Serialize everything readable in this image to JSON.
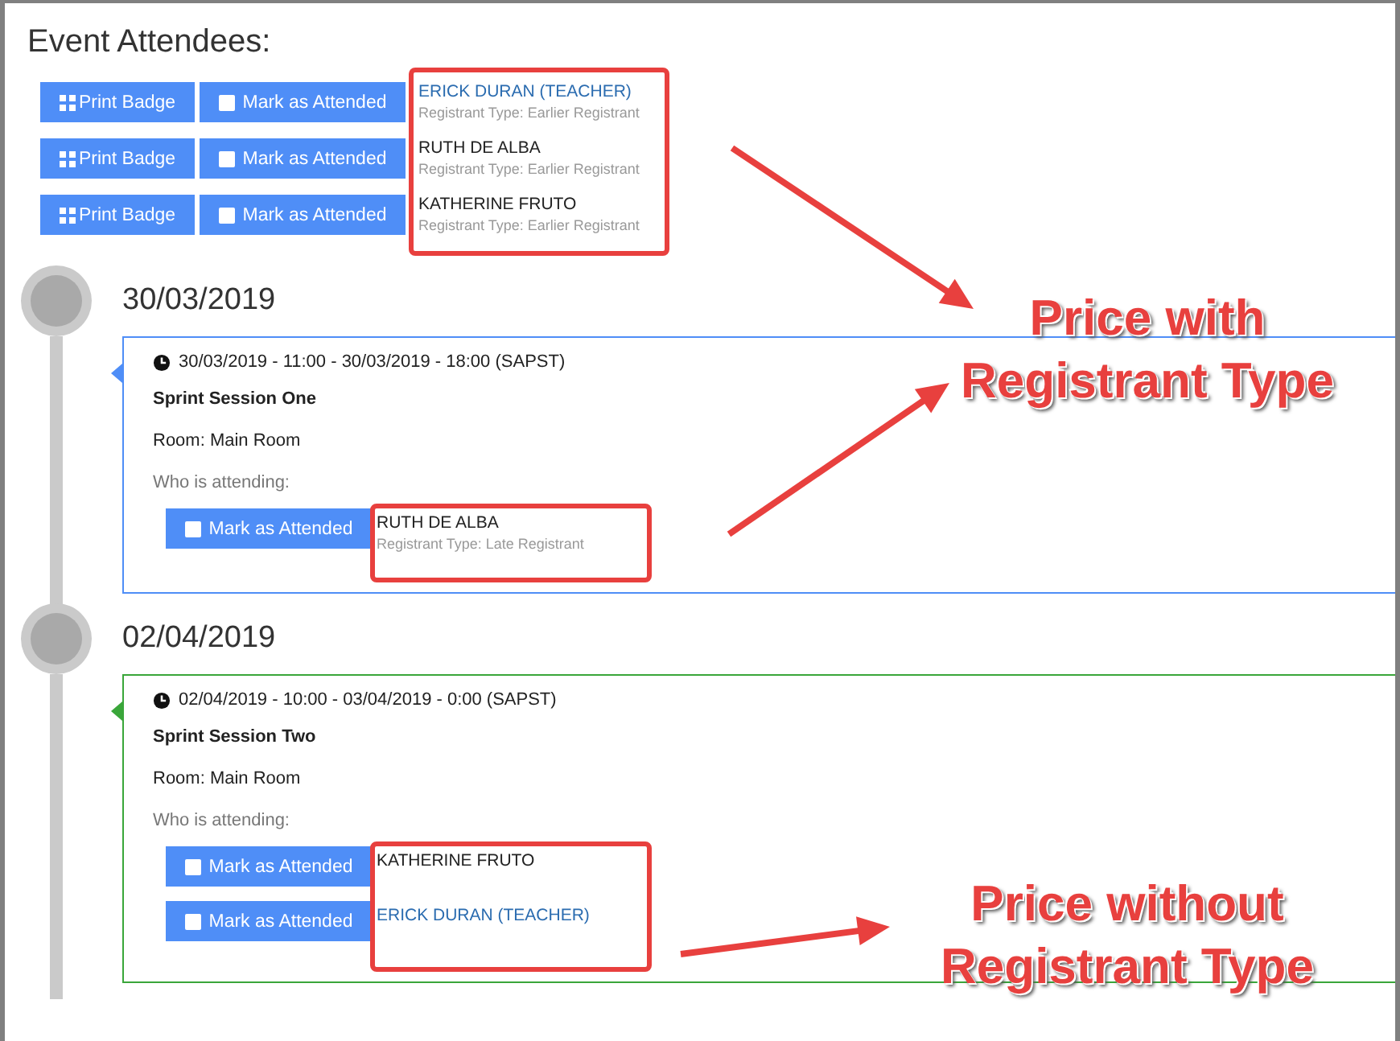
{
  "title": "Event Attendees:",
  "attendees": [
    {
      "print_label": "Print Badge",
      "mark_label": "Mark as Attended",
      "checked": false,
      "name": "ERICK DURAN (TEACHER)",
      "link": true,
      "type": "Registrant Type: Earlier Registrant"
    },
    {
      "print_label": "Print Badge",
      "mark_label": "Mark as Attended",
      "checked": false,
      "name": "RUTH DE ALBA",
      "link": false,
      "type": "Registrant Type: Earlier Registrant"
    },
    {
      "print_label": "Print Badge",
      "mark_label": "Mark as Attended",
      "checked": false,
      "name": "KATHERINE FRUTO",
      "link": false,
      "type": "Registrant Type: Earlier Registrant"
    }
  ],
  "sessions": [
    {
      "date": "30/03/2019",
      "color": "#4f8ef7",
      "time": "30/03/2019 - 11:00 - 30/03/2019 - 18:00 (SAPST)",
      "name": "Sprint Session One",
      "room": "Room: Main Room",
      "attending_label": "Who is attending:",
      "attendees": [
        {
          "mark_label": "Mark as Attended",
          "checked": false,
          "name": "RUTH DE ALBA",
          "link": false,
          "type": "Registrant Type: Late Registrant"
        }
      ]
    },
    {
      "date": "02/04/2019",
      "color": "#3aa63a",
      "time": "02/04/2019 - 10:00 - 03/04/2019 - 0:00 (SAPST)",
      "name": "Sprint Session Two",
      "room": "Room: Main Room",
      "attending_label": "Who is attending:",
      "attendees": [
        {
          "mark_label": "Mark as Attended",
          "checked": false,
          "name": "KATHERINE FRUTO",
          "link": false
        },
        {
          "mark_label": "Mark as Attended",
          "checked": false,
          "name": "ERICK DURAN (TEACHER)",
          "link": true
        }
      ]
    }
  ],
  "annotations": [
    {
      "text": "Price with Registrant Type"
    },
    {
      "text": "Price without Registrant Type"
    }
  ]
}
